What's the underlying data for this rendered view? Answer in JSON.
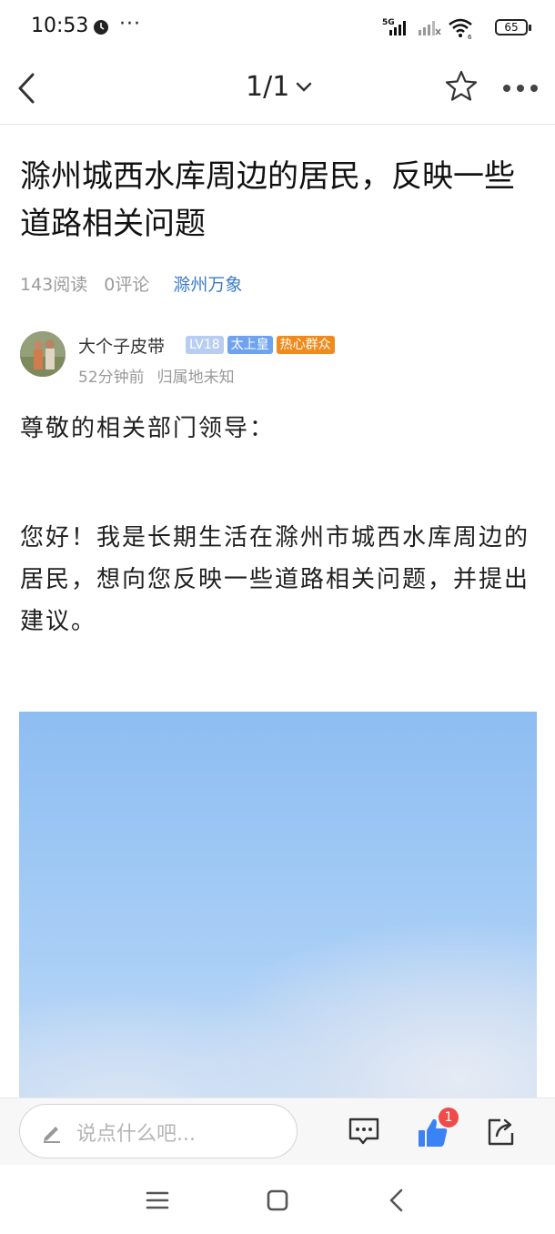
{
  "status_bar": {
    "time": "10:53",
    "more": "···",
    "network": "5G",
    "battery": "65"
  },
  "nav": {
    "pager": "1/1",
    "back_icon": "chevron-left-icon",
    "dropdown_icon": "chevron-down-icon",
    "favorite_icon": "star-outline-icon",
    "more_icon": "more-horizontal-icon"
  },
  "article": {
    "title": "滁州城西水库周边的居民，反映一些道路相关问题",
    "reads": "143阅读",
    "comments": "0评论",
    "topic": "滁州万象",
    "author": {
      "name": "大个子皮带",
      "level": "LV18",
      "role": "太上皇",
      "tag": "热心群众",
      "time": "52分钟前",
      "location": "归属地未知"
    },
    "paragraphs": [
      "尊敬的相关部门领导：",
      "您好！我是长期生活在滁州市城西水库周边的居民，想向您反映一些道路相关问题，并提出建议。"
    ]
  },
  "comment_bar": {
    "placeholder": "说点什么吧...",
    "like_count": "1",
    "icons": [
      "pen-icon",
      "comment-icon",
      "thumbs-up-icon",
      "share-icon"
    ]
  },
  "colors": {
    "link": "#3a7bc8",
    "hot_badge": "#f08a1c",
    "role_badge": "#6fa3ef",
    "level_badge": "#b9cdf0",
    "like": "#3b82f6",
    "count_badge": "#f04a4a"
  }
}
